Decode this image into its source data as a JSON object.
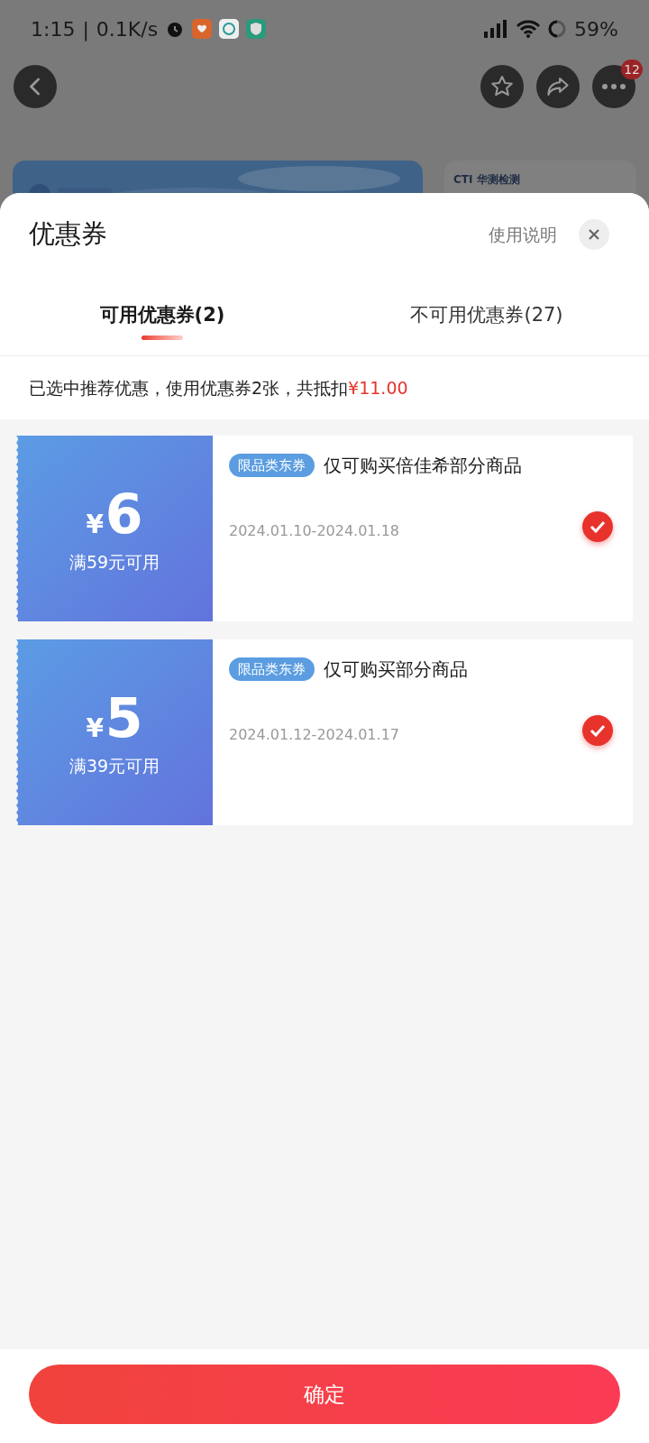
{
  "status_bar": {
    "time": "1:15",
    "separator": "|",
    "speed": "0.1K/s",
    "battery": "59%"
  },
  "nav": {
    "badge": "12"
  },
  "background": {
    "card_text": "CTI 华测检测"
  },
  "sheet": {
    "title": "优惠券",
    "help": "使用说明",
    "tabs": [
      {
        "label": "可用优惠券(2)",
        "selected": true
      },
      {
        "label": "不可用优惠券(27)",
        "selected": false
      }
    ],
    "summary": "已选中推荐优惠，使用优惠券2张，共抵扣",
    "summary_amount": "¥11.00",
    "coupons": [
      {
        "currency": "¥",
        "amount": "6",
        "condition": "满59元可用",
        "tag": "限品类东券",
        "title": "仅可购买倍佳希部分商品",
        "dates": "2024.01.10-2024.01.18",
        "selected": true
      },
      {
        "currency": "¥",
        "amount": "5",
        "condition": "满39元可用",
        "tag": "限品类东券",
        "title": "仅可购买部分商品",
        "dates": "2024.01.12-2024.01.17",
        "selected": true
      }
    ],
    "confirm": "确定"
  }
}
